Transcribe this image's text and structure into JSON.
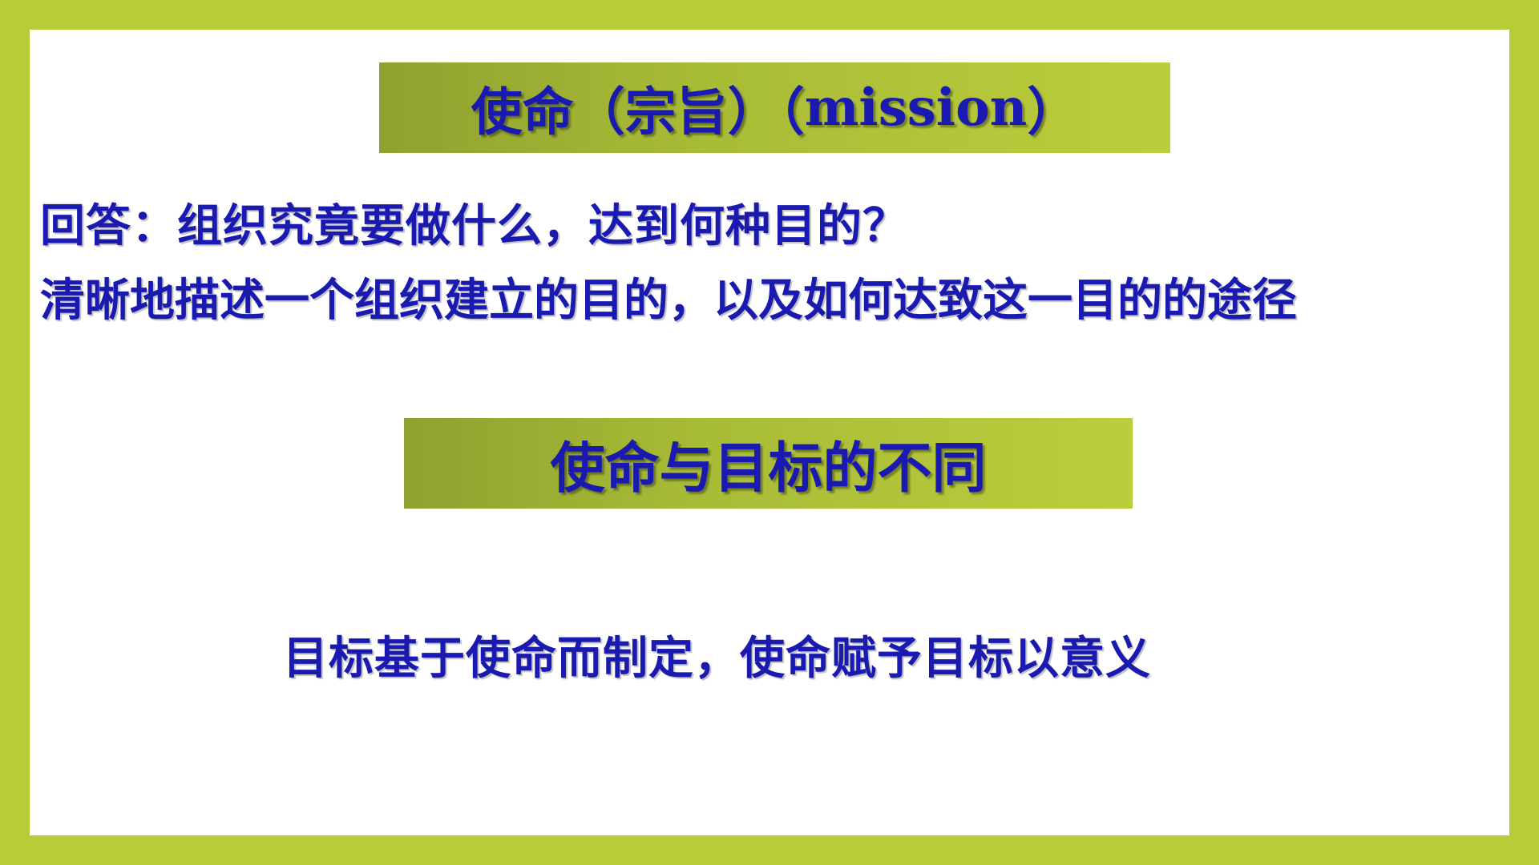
{
  "slide": {
    "title": "使命（宗旨）（",
    "title_latin": "mission",
    "title_end": "）",
    "question_line": "回答：组织究竟要做什么，达到何种目的？",
    "description_line": "清晰地描述一个组织建立的目的，以及如何达致这一目的的途径",
    "subtitle": "使命与目标的不同",
    "conclusion_line": "目标基于使命而制定，使命赋予目标以意义"
  },
  "colors": {
    "frame": "#b8cc3a",
    "banner_start": "#8fa130",
    "banner_end": "#bccd3c",
    "text": "#1a1ab0",
    "background": "#ffffff"
  }
}
